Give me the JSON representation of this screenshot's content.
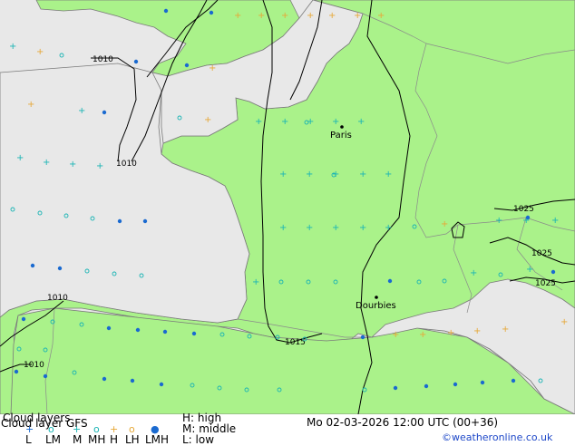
{
  "colors": {
    "land": "#aaf28a",
    "sea": "#e8e8e8",
    "border": "#8a8a8a",
    "coast": "#7a7a7a",
    "isobar": "#000000",
    "high": "#e6a838",
    "mid": "#1ab4b4",
    "low_cyan": "#1ab4b4",
    "lmh": "#1a6ad0"
  },
  "map": {
    "isobar_labels": [
      "1010",
      "1010",
      "1010",
      "1010",
      "1015",
      "1025",
      "1025",
      "1025"
    ],
    "cities": [
      "Paris",
      "Dourbies"
    ]
  },
  "footer": {
    "title_line1": "Cloud layers",
    "title_line2": "Cloud layer GFS",
    "legend_codes": [
      "L",
      "LM",
      "M",
      "MH",
      "H",
      "LH",
      "LMH"
    ],
    "key_high": "H: high",
    "key_middle": "M: middle",
    "key_low": "L: low",
    "datetime": "Mo 02-03-2026 12:00 UTC (00+36)",
    "credit": "©weatheronline.co.uk"
  }
}
